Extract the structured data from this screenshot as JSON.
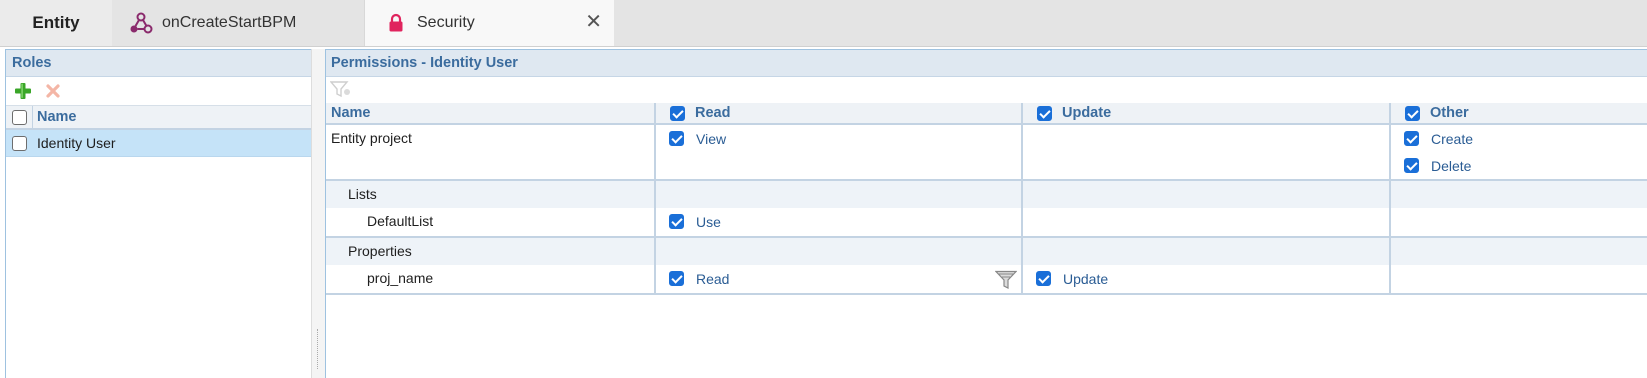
{
  "tabs": [
    {
      "label": "Entity",
      "icon": "entity-tab"
    },
    {
      "label": "onCreateStartBPM",
      "icon": "workflow-icon"
    },
    {
      "label": "Security",
      "icon": "lock-icon",
      "close_icon": "close-icon",
      "close_label": "✕"
    }
  ],
  "roles": {
    "title": "Roles",
    "add_icon": "add-icon",
    "delete_icon": "delete-icon",
    "column_name": "Name",
    "items": [
      {
        "name": "Identity User",
        "selected": true,
        "checked": false
      }
    ]
  },
  "permissions": {
    "title": "Permissions - Identity User",
    "filter_icon": "filter-icon",
    "columns": {
      "name": "Name",
      "read": "Read",
      "update": "Update",
      "other": "Other"
    },
    "rows": {
      "entity": {
        "name": "Entity project",
        "read": "View",
        "create": "Create",
        "delete": "Delete"
      },
      "lists_group": "Lists",
      "list_item": {
        "name": "DefaultList",
        "read": "Use"
      },
      "properties_group": "Properties",
      "property_item": {
        "name": "proj_name",
        "read": "Read",
        "update": "Update"
      }
    }
  },
  "colors": {
    "accent": "#1a6fd8",
    "header_text": "#3b6c9e",
    "selected_row": "#c5e3f8",
    "panel_border": "#9ec2e0",
    "security_lock": "#e0245e",
    "workflow_icon": "#8a2a6c"
  }
}
